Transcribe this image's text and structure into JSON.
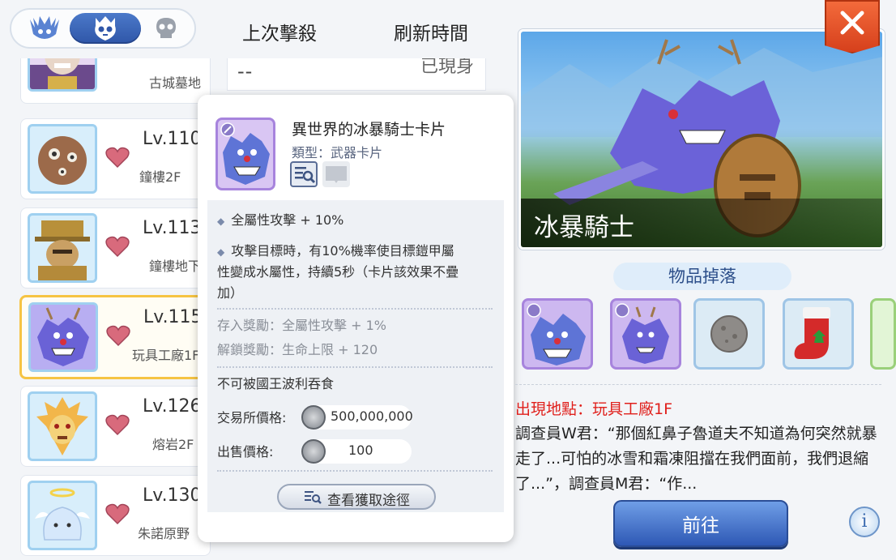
{
  "header": {
    "last_kill": "上次擊殺",
    "refresh_time": "刷新時間"
  },
  "list": {
    "row0": {
      "location": "古城墓地",
      "last_kill": "--",
      "status": "已現身"
    },
    "rows": [
      {
        "level": "Lv.110",
        "location": "鐘樓2F"
      },
      {
        "level": "Lv.113",
        "location": "鐘樓地下"
      },
      {
        "level": "Lv.115",
        "location": "玩具工廠1F"
      },
      {
        "level": "Lv.126",
        "location": "熔岩2F"
      },
      {
        "level": "Lv.130",
        "location": "朱諾原野"
      }
    ]
  },
  "tooltip": {
    "name": "異世界的冰暴騎士卡片",
    "type": "類型：武器卡片",
    "effect1": "全屬性攻擊 + 10%",
    "effect2_l1": "攻擊目標時，有10%機率使目標鎧甲屬",
    "effect2_l2": "性變成水屬性，持續5秒（卡片該效果不疊",
    "effect2_l3": "加）",
    "deposit": "存入獎勵：全屬性攻擊 + 1%",
    "unlock": "解鎖獎勵：生命上限 + 120",
    "not_eaten": "不可被國王波利吞食",
    "exchange_label": "交易所價格:",
    "exchange_price": "500,000,000",
    "sell_label": "出售價格:",
    "sell_price": "100",
    "route_button": "查看獲取途徑"
  },
  "boss": {
    "name": "冰暴騎士",
    "drops_title": "物品掉落",
    "location": "出現地點：玩具工廠1F",
    "description": "調查員W君：“那個紅鼻子魯道夫不知道為何突然就暴走了...可怕的冰雪和霜凍阻擋在我們面前，我們退縮了...”，調查員M君：“作...",
    "go_button": "前往",
    "info_button": "i"
  }
}
